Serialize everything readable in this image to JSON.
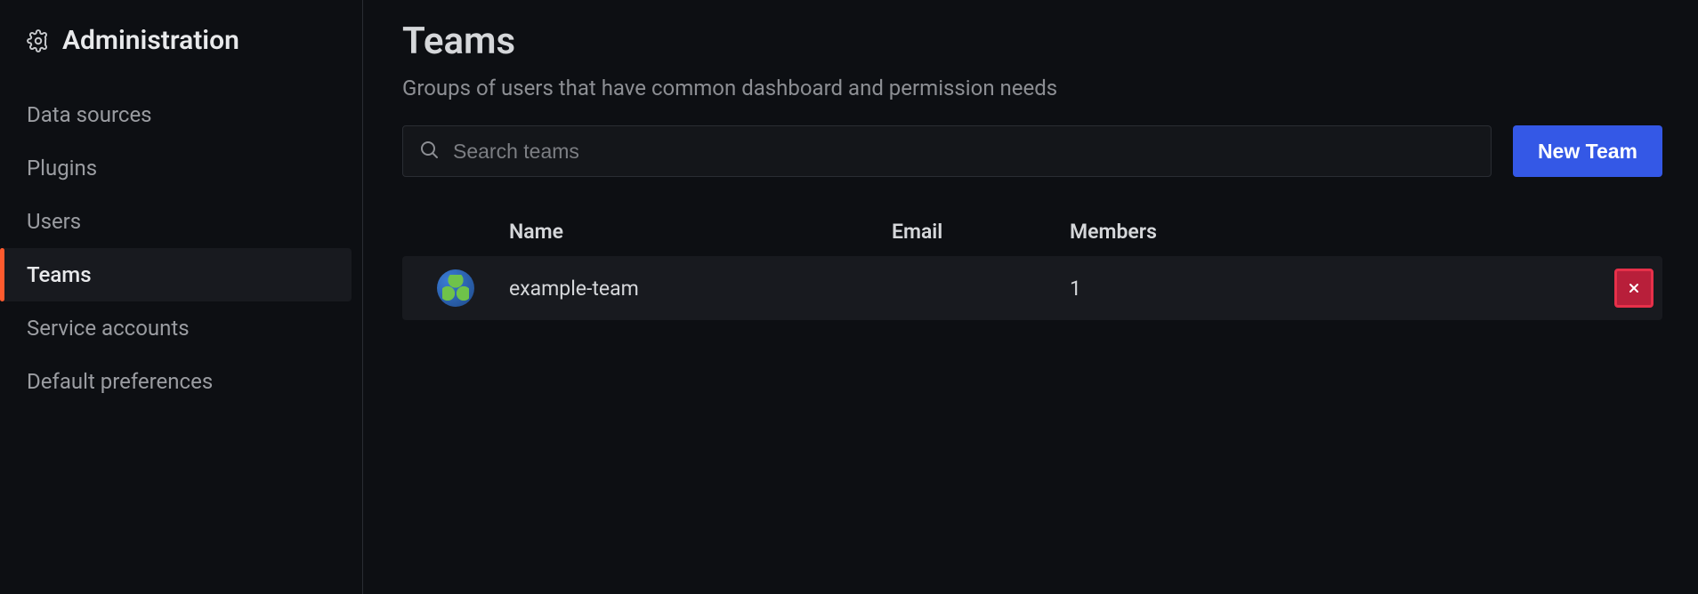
{
  "sidebar": {
    "title": "Administration",
    "items": [
      {
        "label": "Data sources",
        "active": false
      },
      {
        "label": "Plugins",
        "active": false
      },
      {
        "label": "Users",
        "active": false
      },
      {
        "label": "Teams",
        "active": true
      },
      {
        "label": "Service accounts",
        "active": false
      },
      {
        "label": "Default preferences",
        "active": false
      }
    ]
  },
  "page": {
    "title": "Teams",
    "subtitle": "Groups of users that have common dashboard and permission needs"
  },
  "toolbar": {
    "search_placeholder": "Search teams",
    "new_team_label": "New Team"
  },
  "table": {
    "headers": {
      "name": "Name",
      "email": "Email",
      "members": "Members"
    },
    "rows": [
      {
        "name": "example-team",
        "email": "",
        "members": "1"
      }
    ]
  }
}
